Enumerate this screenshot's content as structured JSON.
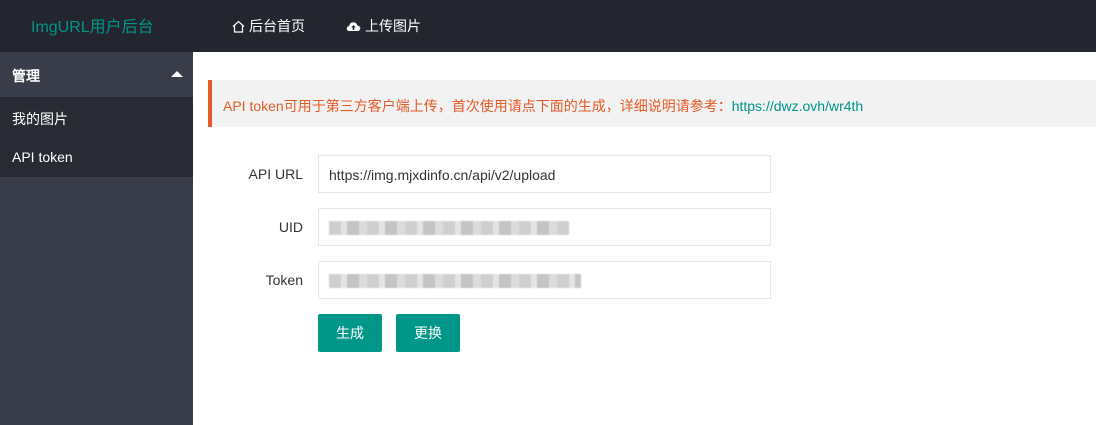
{
  "header": {
    "logo": "ImgURL用户后台",
    "nav": [
      {
        "label": "后台首页",
        "icon": "home-icon"
      },
      {
        "label": "上传图片",
        "icon": "cloud-upload-icon"
      }
    ]
  },
  "sidebar": {
    "group_title": "管理",
    "items": [
      {
        "label": "我的图片"
      },
      {
        "label": "API token"
      }
    ]
  },
  "notice": {
    "text": "API token可用于第三方客户端上传，首次使用请点下面的生成，详细说明请参考：",
    "link": "https://dwz.ovh/wr4th"
  },
  "form": {
    "api_url_label": "API URL",
    "api_url_value": "https://img.mjxdinfo.cn/api/v2/upload",
    "uid_label": "UID",
    "token_label": "Token"
  },
  "buttons": {
    "generate": "生成",
    "replace": "更换"
  },
  "colors": {
    "accent": "#009688",
    "warning": "#e45b29",
    "topbar": "#23262e",
    "sidebar": "#393d49"
  }
}
